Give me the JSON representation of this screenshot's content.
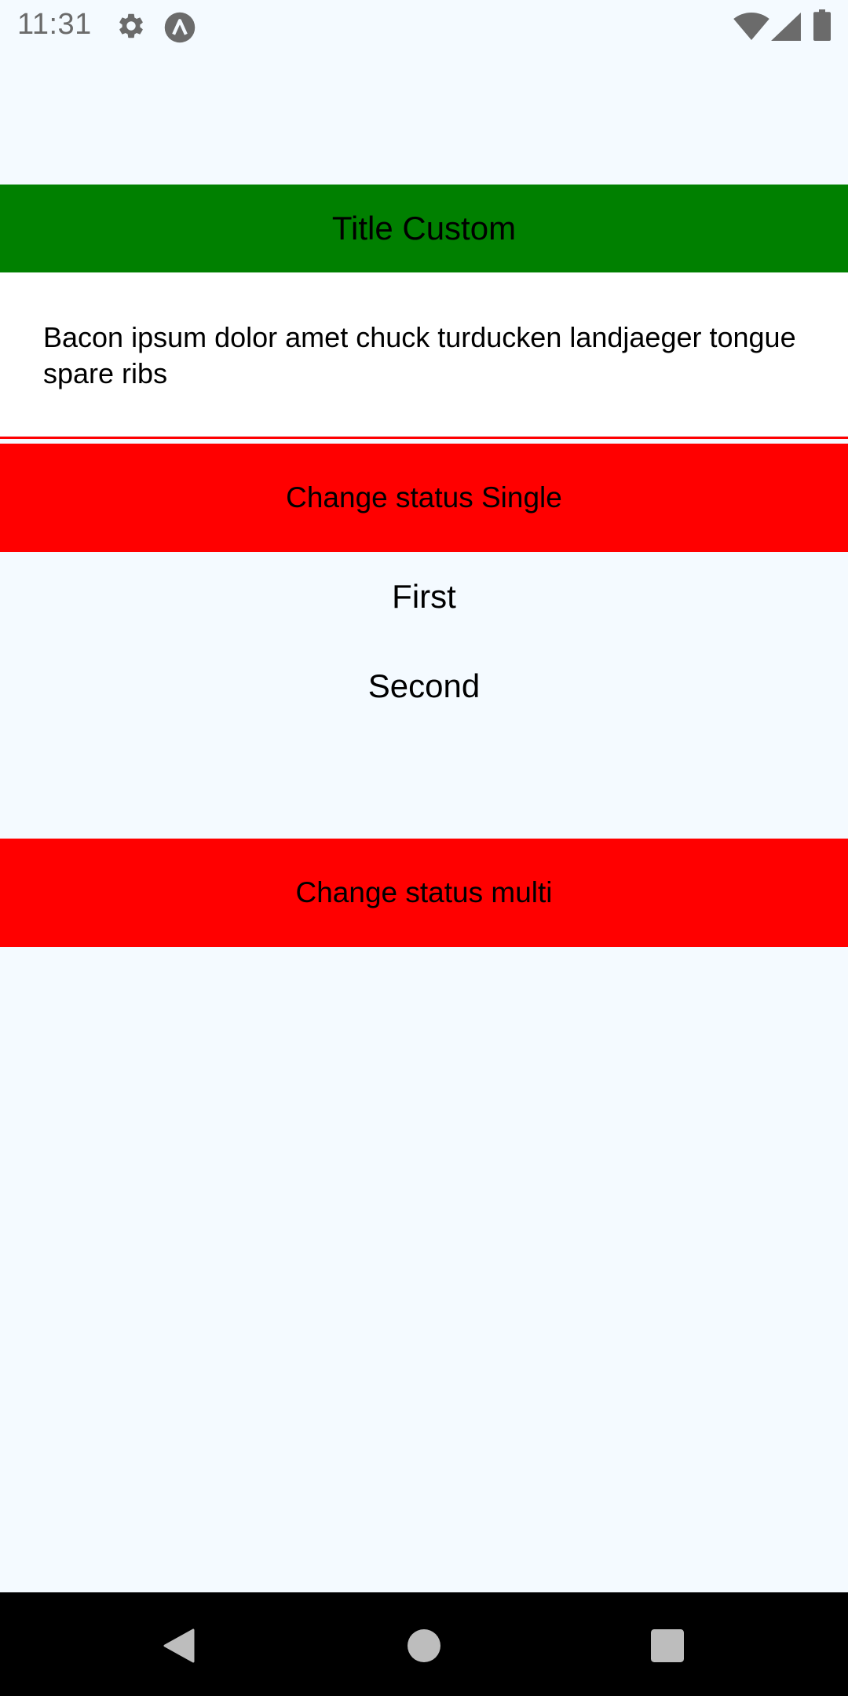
{
  "status_bar": {
    "time": "11:31",
    "icons": [
      "gear-icon",
      "app-logo-icon",
      "wifi-icon",
      "signal-icon",
      "battery-icon"
    ]
  },
  "header": {
    "title": "Title Custom",
    "background": "#008000"
  },
  "content": {
    "text": "Bacon ipsum dolor amet chuck turducken landjaeger tongue spare ribs"
  },
  "buttons": {
    "single_label": "Change status Single",
    "multi_label": "Change status multi",
    "color": "#ff0000"
  },
  "list": {
    "items": [
      "First",
      "Second"
    ]
  },
  "nav_bar": {
    "icons": [
      "back-icon",
      "home-icon",
      "recents-icon"
    ]
  }
}
